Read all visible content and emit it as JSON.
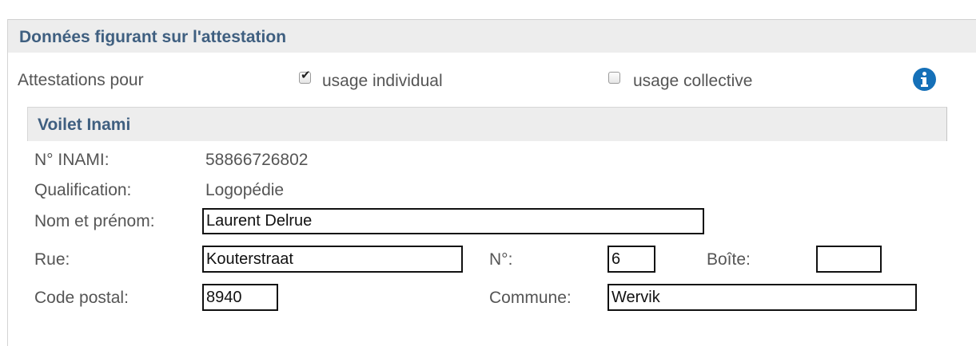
{
  "section": {
    "title": "Données figurant sur l'attestation",
    "attestations_label": "Attestations pour",
    "usage_individual": {
      "label": "usage individual",
      "checked": true
    },
    "usage_collective": {
      "label": "usage collective",
      "checked": false
    },
    "info_icon": "info-circle-icon"
  },
  "provider": {
    "title": "Voilet Inami",
    "inami_label": "N° INAMI:",
    "inami_value": "58866726802",
    "qualification_label": "Qualification:",
    "qualification_value": "Logopédie",
    "name_label": "Nom et prénom:",
    "name_value": "Laurent Delrue",
    "street_label": "Rue:",
    "street_value": "Kouterstraat",
    "number_label": "N°:",
    "number_value": "6",
    "box_label": "Boîte:",
    "box_value": "",
    "postal_label": "Code postal:",
    "postal_value": "8940",
    "commune_label": "Commune:",
    "commune_value": "Wervik"
  },
  "colors": {
    "header_bg": "#ededed",
    "header_text": "#3f5f80",
    "info_icon": "#1570b8"
  }
}
